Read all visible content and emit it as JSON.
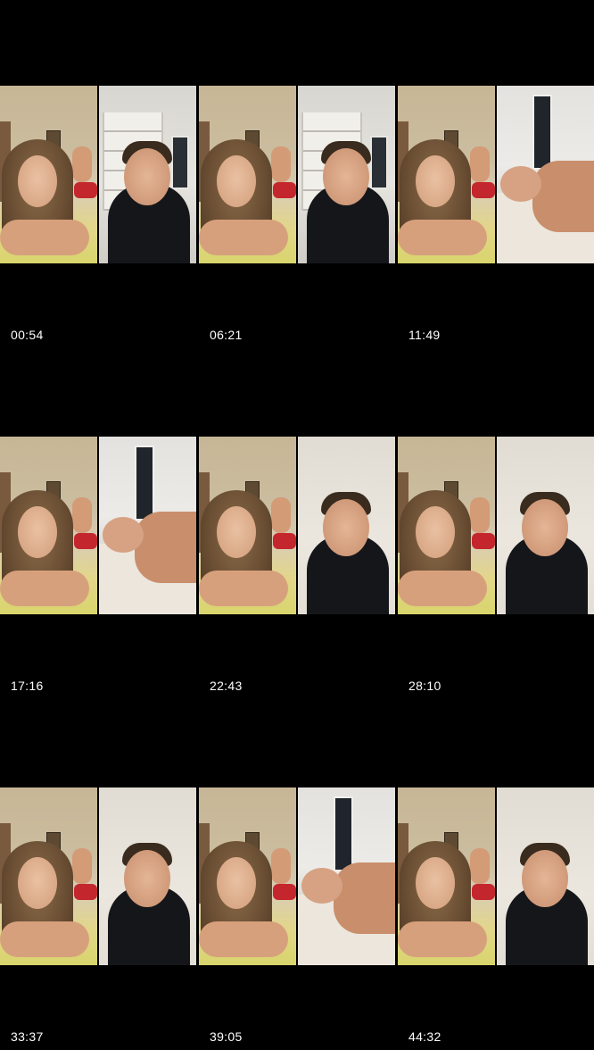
{
  "thumbnails": [
    {
      "timestamp": "00:54",
      "right_scene": "shelf"
    },
    {
      "timestamp": "06:21",
      "right_scene": "shelf"
    },
    {
      "timestamp": "11:49",
      "right_scene": "bed"
    },
    {
      "timestamp": "17:16",
      "right_scene": "bed"
    },
    {
      "timestamp": "22:43",
      "right_scene": "wall"
    },
    {
      "timestamp": "28:10",
      "right_scene": "wall"
    },
    {
      "timestamp": "33:37",
      "right_scene": "wall"
    },
    {
      "timestamp": "39:05",
      "right_scene": "bed"
    },
    {
      "timestamp": "44:32",
      "right_scene": "wall"
    }
  ],
  "colors": {
    "background": "#000000",
    "timestamp_text": "#ffffff"
  }
}
